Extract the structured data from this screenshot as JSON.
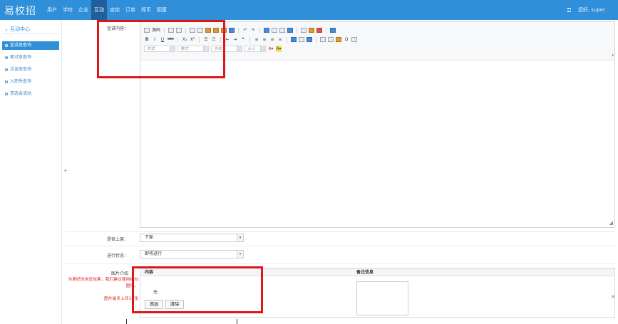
{
  "app": {
    "logo": "易校招"
  },
  "nav": {
    "items": [
      {
        "label": "用户",
        "active": false
      },
      {
        "label": "学校",
        "active": false
      },
      {
        "label": "企业",
        "active": false
      },
      {
        "label": "互动",
        "active": true
      },
      {
        "label": "宣控",
        "active": false
      },
      {
        "label": "订单",
        "active": false
      },
      {
        "label": "简币",
        "active": false
      },
      {
        "label": "配置",
        "active": false
      }
    ],
    "user_label": "您好, super"
  },
  "sidebar": {
    "section": "互动中心",
    "items": [
      {
        "label": "宣讲室查询",
        "active": true
      },
      {
        "label": "面试室查询",
        "active": false
      },
      {
        "label": "洽谈室查询",
        "active": false
      },
      {
        "label": "入职秀查询",
        "active": false
      },
      {
        "label": "双选会活动",
        "active": false
      }
    ]
  },
  "form": {
    "content_label": "宣讲内容：",
    "editor_toolbar": {
      "source_label": "源码",
      "bold": "B",
      "italic": "I",
      "underline": "U",
      "strike": "abc",
      "sub": "X₂",
      "sup": "X²",
      "style_placeholder": "样式",
      "format_placeholder": "格式",
      "font_placeholder": "字体",
      "size_placeholder": "大小"
    },
    "online_label": "是否上架：",
    "online_value": "下架",
    "status_label": "进行状态：",
    "status_value": "即将进行",
    "image_label": "图片介绍",
    "image_hint": "为更好的浏览效果，我们建议使用横向图片。",
    "image_limit": "图片最多上传10张",
    "table_headers": {
      "content": "内容",
      "remark": "备注信息"
    },
    "none_text": "无",
    "add_button": "添加",
    "clear_button": "清除"
  },
  "colors": {
    "topbar": "#2f8fd8",
    "nav_active": "#1f5f9c",
    "highlight": "#e01515",
    "hint": "#e0281c"
  }
}
